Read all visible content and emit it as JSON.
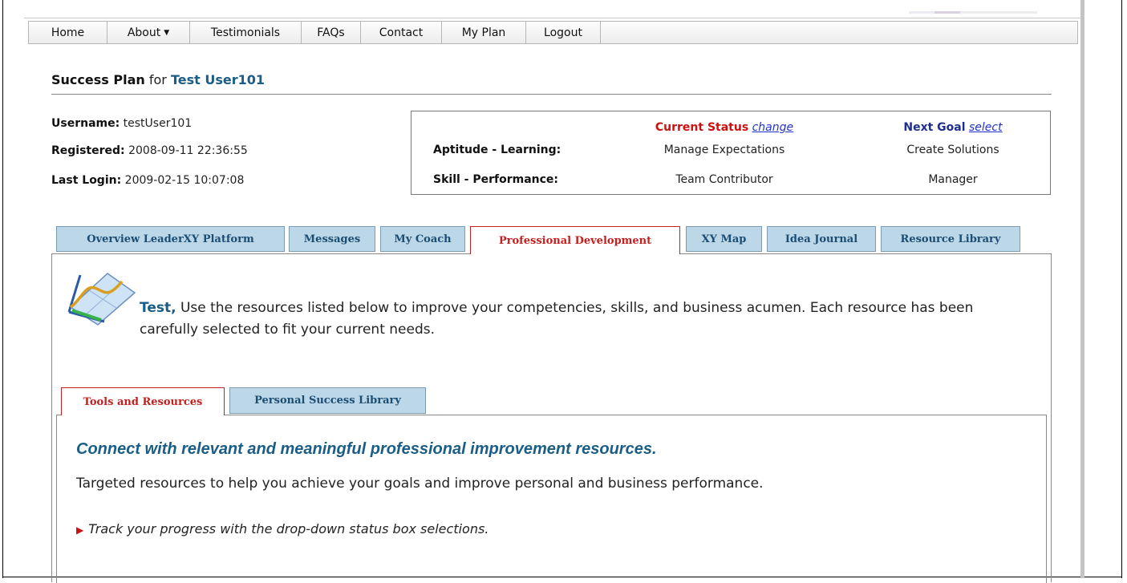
{
  "nav": {
    "items": [
      {
        "label": "Home"
      },
      {
        "label": "About",
        "has_dropdown": true
      },
      {
        "label": "Testimonials"
      },
      {
        "label": "FAQs"
      },
      {
        "label": "Contact"
      },
      {
        "label": "My Plan"
      },
      {
        "label": "Logout"
      }
    ]
  },
  "header": {
    "title_prefix": "Success Plan",
    "title_for": "for",
    "user_name": "Test User101"
  },
  "account": {
    "username_label": "Username:",
    "username": "testUser101",
    "registered_label": "Registered:",
    "registered": "2008-09-11 22:36:55",
    "last_login_label": "Last Login:",
    "last_login": "2009-02-15 10:07:08"
  },
  "status": {
    "current_label": "Current Status",
    "current_action": "change",
    "next_label": "Next Goal",
    "next_action": "select",
    "rows": [
      {
        "label": "Aptitude - Learning:",
        "current": "Manage Expectations",
        "next": "Create Solutions"
      },
      {
        "label": "Skill - Performance:",
        "current": "Team Contributor",
        "next": "Manager"
      }
    ]
  },
  "tabs": [
    {
      "label": "Overview LeaderXY Platform"
    },
    {
      "label": "Messages"
    },
    {
      "label": "My Coach"
    },
    {
      "label": "Professional Development",
      "active": true
    },
    {
      "label": "XY Map"
    },
    {
      "label": "Idea Journal"
    },
    {
      "label": "Resource Library"
    }
  ],
  "intro": {
    "first_name": "Test,",
    "text": " Use the resources listed below to improve your competencies, skills, and business acumen. Each resource has been carefully selected to fit your current needs.",
    "icon": "chart-icon"
  },
  "subtabs": [
    {
      "label": "Tools and Resources",
      "active": true
    },
    {
      "label": "Personal Success Library"
    }
  ],
  "content": {
    "heading": "Connect with relevant and meaningful professional improvement resources.",
    "text": "Targeted resources to help you achieve your goals and improve personal and business performance.",
    "bullet": "Track your progress with the drop-down status box selections."
  },
  "colors": {
    "accent_blue": "#1a5d86",
    "active_red": "#c42020",
    "tab_bg": "#bcd7e8"
  }
}
